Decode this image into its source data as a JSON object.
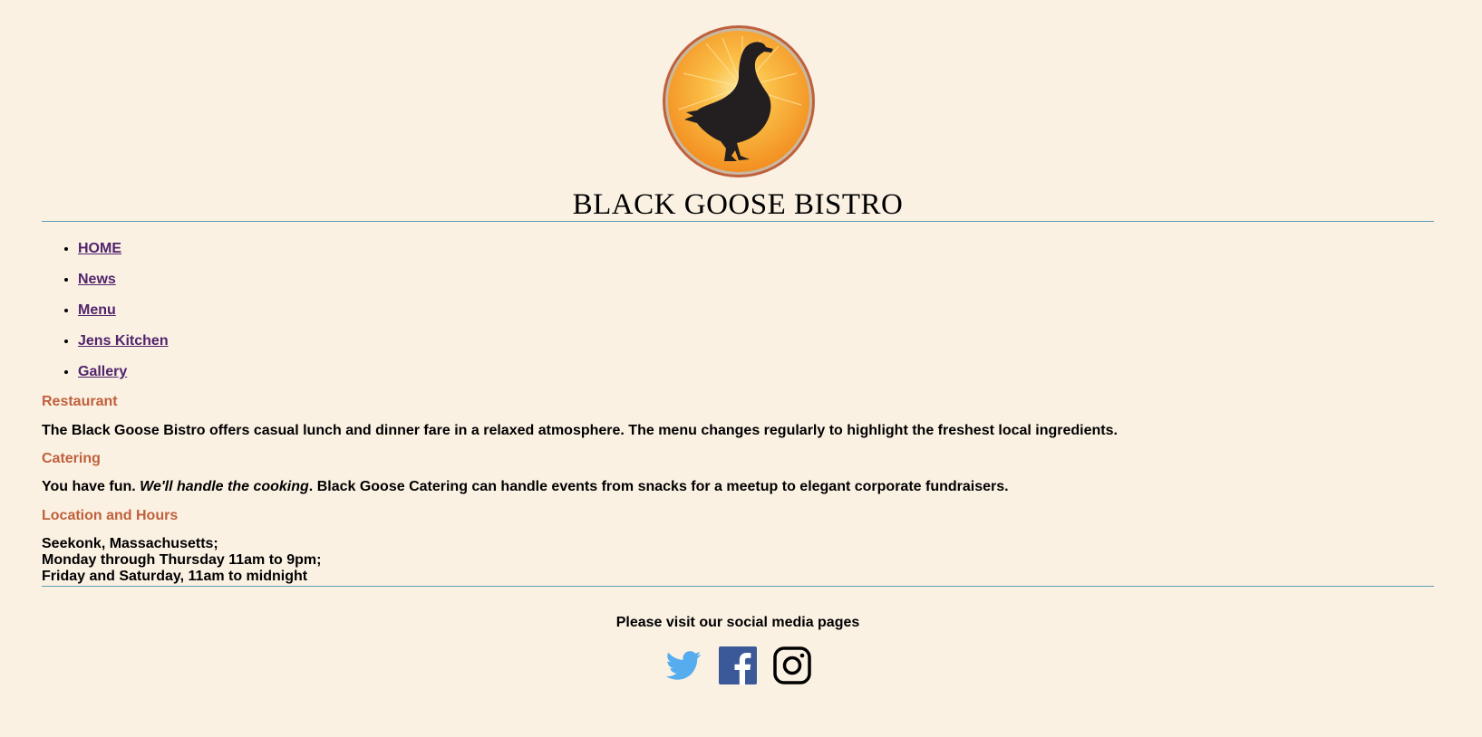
{
  "header": {
    "title": "BLACK GOOSE BISTRO",
    "logo_icon": "goose-logo-icon"
  },
  "nav": {
    "items": [
      {
        "label": "HOME"
      },
      {
        "label": "News"
      },
      {
        "label": "Menu"
      },
      {
        "label": "Jens Kitchen"
      },
      {
        "label": "Gallery"
      }
    ]
  },
  "sections": {
    "restaurant": {
      "heading": "Restaurant",
      "text": "The Black Goose Bistro offers casual lunch and dinner fare in a relaxed atmosphere. The menu changes regularly to highlight the freshest local ingredients."
    },
    "catering": {
      "heading": "Catering",
      "text_before": "You have fun. ",
      "text_emphasis": "We'll handle the cooking",
      "text_after": ". Black Goose Catering can handle events from snacks for a meetup to elegant corporate fundraisers."
    },
    "location": {
      "heading": "Location and Hours",
      "lines": [
        "Seekonk, Massachusetts;",
        "Monday through Thursday 11am to 9pm;",
        "Friday and Saturday, 11am to midnight"
      ]
    }
  },
  "footer": {
    "text": "Please visit our social media pages",
    "social": [
      {
        "icon": "twitter-icon",
        "color": "#55acee"
      },
      {
        "icon": "facebook-icon",
        "color": "#3b5998"
      },
      {
        "icon": "instagram-icon",
        "color": "#000000"
      }
    ]
  },
  "colors": {
    "background": "#faf1e3",
    "heading": "#c0603c",
    "link": "#51236b",
    "rule": "#5b9bb5"
  }
}
